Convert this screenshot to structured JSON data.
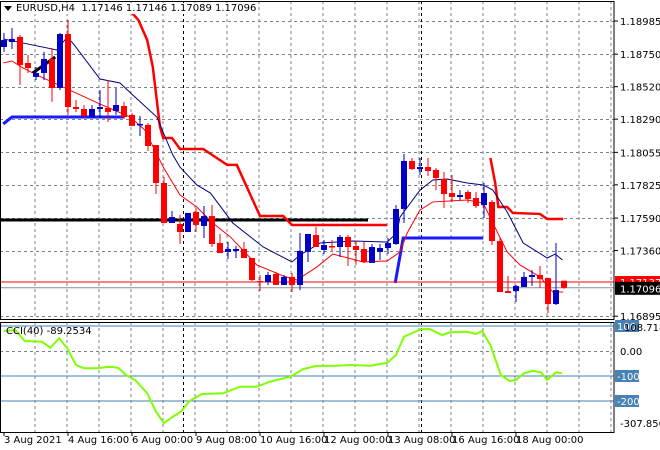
{
  "header": {
    "symbol": "EURUSD,H4",
    "open": "1.17146",
    "high": "1.17146",
    "low": "1.17089",
    "close": "1.17096"
  },
  "colors": {
    "bull": "#0000c8",
    "bear": "#ff0000",
    "doji": "#00c800",
    "ma_fast": "#ff0000",
    "ma_slow": "#000080",
    "stop_red": "#ff0000",
    "stop_blue": "#1a1aff",
    "level_black": "#000000",
    "cci": "#7fff00",
    "cci_levels": "#4682b4",
    "grid": "#7a8290"
  },
  "chart_data": [
    {
      "type": "candlestick",
      "title": "EURUSD,H4",
      "price_axis": {
        "ticks": [
          "1.18985",
          "1.18750",
          "1.18520",
          "1.18290",
          "1.18055",
          "1.17825",
          "1.17590",
          "1.17360",
          "1.16895"
        ],
        "range": [
          1.16895,
          1.18985
        ]
      },
      "time_axis": {
        "labels": [
          {
            "text": "3 Aug 2021",
            "bar": 1
          },
          {
            "text": "4 Aug 16:00",
            "bar": 9
          },
          {
            "text": "6 Aug 00:00",
            "bar": 17
          },
          {
            "text": "9 Aug 08:00",
            "bar": 25
          },
          {
            "text": "10 Aug 16:00",
            "bar": 33
          },
          {
            "text": "12 Aug 00:00",
            "bar": 41
          },
          {
            "text": "13 Aug 08:00",
            "bar": 49
          },
          {
            "text": "16 Aug 16:00",
            "bar": 57
          },
          {
            "text": "18 Aug 00:00",
            "bar": 65
          }
        ],
        "day_separators": [
          23.4,
          53.1
        ]
      },
      "ohlc": [
        [
          1.18801,
          1.189,
          1.18766,
          1.1885
        ],
        [
          1.18836,
          1.18935,
          1.18787,
          1.18858
        ],
        [
          1.18872,
          1.18886,
          1.18532,
          1.18673
        ],
        [
          1.18688,
          1.18744,
          1.18617,
          1.18652
        ],
        [
          1.18589,
          1.18659,
          1.18567,
          1.18617
        ],
        [
          1.18617,
          1.18766,
          1.18567,
          1.18716
        ],
        [
          1.18716,
          1.18794,
          1.18412,
          1.18511
        ],
        [
          1.18511,
          1.189,
          1.18496,
          1.18893
        ],
        [
          1.18893,
          1.18992,
          1.1832,
          1.18376
        ],
        [
          1.18376,
          1.18426,
          1.18341,
          1.18362
        ],
        [
          1.18362,
          1.1839,
          1.18305,
          1.18313
        ],
        [
          1.18305,
          1.1839,
          1.18298,
          1.18362
        ],
        [
          1.18362,
          1.18496,
          1.18298,
          1.18376
        ],
        [
          1.18369,
          1.18567,
          1.1827,
          1.18341
        ],
        [
          1.18348,
          1.18511,
          1.1832,
          1.1839
        ],
        [
          1.18383,
          1.18412,
          1.18298,
          1.18305
        ],
        [
          1.1832,
          1.18334,
          1.18242,
          1.18242
        ],
        [
          1.18256,
          1.18313,
          1.18171,
          1.18256
        ],
        [
          1.18249,
          1.18263,
          1.18065,
          1.181
        ],
        [
          1.18107,
          1.18107,
          1.1776,
          1.17838
        ],
        [
          1.17838,
          1.17881,
          1.17555,
          1.17555
        ],
        [
          1.17555,
          1.1764,
          1.17555,
          1.17597
        ],
        [
          1.17548,
          1.17612,
          1.17406,
          1.17491
        ],
        [
          1.17491,
          1.17626,
          1.17491,
          1.17626
        ],
        [
          1.17633,
          1.17661,
          1.17491,
          1.17541
        ],
        [
          1.17534,
          1.17675,
          1.17449,
          1.17604
        ],
        [
          1.17604,
          1.17682,
          1.17385,
          1.17406
        ],
        [
          1.17413,
          1.17477,
          1.17342,
          1.17342
        ],
        [
          1.1735,
          1.1742,
          1.173,
          1.17371
        ],
        [
          1.17357,
          1.17392,
          1.17307,
          1.17371
        ],
        [
          1.17371,
          1.1742,
          1.17307,
          1.17307
        ],
        [
          1.17307,
          1.17307,
          1.17144,
          1.17151
        ],
        [
          1.17144,
          1.17187,
          1.17073,
          1.17137
        ],
        [
          1.17137,
          1.17208,
          1.17116,
          1.17187
        ],
        [
          1.17194,
          1.17208,
          1.17116,
          1.17116
        ],
        [
          1.17116,
          1.17187,
          1.17116,
          1.17173
        ],
        [
          1.17173,
          1.17201,
          1.17066,
          1.17116
        ],
        [
          1.17116,
          1.17484,
          1.1708,
          1.17357
        ],
        [
          1.1735,
          1.17477,
          1.17279,
          1.17477
        ],
        [
          1.1747,
          1.17527,
          1.17385,
          1.17385
        ],
        [
          1.17364,
          1.17435,
          1.17335,
          1.17399
        ],
        [
          1.17392,
          1.17435,
          1.17357,
          1.17385
        ],
        [
          1.17385,
          1.1747,
          1.17314,
          1.17456
        ],
        [
          1.17456,
          1.1747,
          1.1725,
          1.17385
        ],
        [
          1.17392,
          1.17427,
          1.17258,
          1.17364
        ],
        [
          1.17371,
          1.1742,
          1.17272,
          1.17279
        ],
        [
          1.17272,
          1.17406,
          1.17272,
          1.17385
        ],
        [
          1.1735,
          1.17406,
          1.17293,
          1.17378
        ],
        [
          1.17378,
          1.17449,
          1.17335,
          1.17413
        ],
        [
          1.17406,
          1.17682,
          1.17399,
          1.17654
        ],
        [
          1.17654,
          1.18043,
          1.17555,
          1.17994
        ],
        [
          1.17994,
          1.18015,
          1.1793,
          1.17937
        ],
        [
          1.17937,
          1.18015,
          1.17895,
          1.17951
        ],
        [
          1.17951,
          1.18015,
          1.17888,
          1.17923
        ],
        [
          1.1793,
          1.17944,
          1.17788,
          1.17873
        ],
        [
          1.17866,
          1.17916,
          1.17661,
          1.1776
        ],
        [
          1.17767,
          1.17895,
          1.17704,
          1.17739
        ],
        [
          1.17739,
          1.17788,
          1.17718,
          1.17753
        ],
        [
          1.17774,
          1.17788,
          1.17696,
          1.17725
        ],
        [
          1.17732,
          1.17774,
          1.17661,
          1.17675
        ],
        [
          1.17682,
          1.17838,
          1.1759,
          1.17767
        ],
        [
          1.17704,
          1.17718,
          1.17399,
          1.17427
        ],
        [
          1.17427,
          1.17449,
          1.17066,
          1.17066
        ],
        [
          1.17073,
          1.1718,
          1.17059,
          1.17059
        ],
        [
          1.17073,
          1.17116,
          1.16996,
          1.17109
        ],
        [
          1.17102,
          1.17208,
          1.17102,
          1.17173
        ],
        [
          1.17173,
          1.17222,
          1.17109,
          1.17187
        ],
        [
          1.17187,
          1.1725,
          1.17095,
          1.17158
        ],
        [
          1.17165,
          1.17165,
          1.16918,
          1.16981
        ],
        [
          1.16981,
          1.17413,
          1.16974,
          1.1708
        ],
        [
          1.17146,
          1.17146,
          1.17089,
          1.17096
        ]
      ],
      "overlays": {
        "ma_slow": [
          [
            0.9,
            1.18858
          ],
          [
            7.6,
            1.1878
          ],
          [
            8.9,
            1.18872
          ],
          [
            9.6,
            1.18829
          ],
          [
            13,
            1.18574
          ],
          [
            15.5,
            1.18546
          ],
          [
            17.1,
            1.18461
          ],
          [
            20.1,
            1.18305
          ],
          [
            22.1,
            1.18036
          ],
          [
            23,
            1.17951
          ],
          [
            25.1,
            1.17824
          ],
          [
            26.8,
            1.17767
          ],
          [
            29.6,
            1.17555
          ],
          [
            33.4,
            1.17385
          ],
          [
            37,
            1.17279
          ],
          [
            38,
            1.17328
          ],
          [
            40.5,
            1.17413
          ],
          [
            44.6,
            1.17427
          ],
          [
            48.9,
            1.1742
          ],
          [
            50.1,
            1.17484
          ],
          [
            50.5,
            1.17597
          ],
          [
            53,
            1.17788
          ],
          [
            54.6,
            1.17859
          ],
          [
            56.4,
            1.17866
          ],
          [
            58.9,
            1.17838
          ],
          [
            60.9,
            1.17824
          ],
          [
            62.1,
            1.17788
          ],
          [
            63.9,
            1.17633
          ],
          [
            65.9,
            1.17413
          ],
          [
            68.9,
            1.17307
          ],
          [
            69.9,
            1.17335
          ],
          [
            70.8,
            1.17293
          ]
        ],
        "ma_fast": [
          [
            0.9,
            1.18688
          ],
          [
            2,
            1.18702
          ],
          [
            3.4,
            1.18652
          ],
          [
            5.1,
            1.18603
          ],
          [
            8.9,
            1.18504
          ],
          [
            13,
            1.18397
          ],
          [
            16.8,
            1.18305
          ],
          [
            18.6,
            1.18213
          ],
          [
            20.9,
            1.17951
          ],
          [
            23,
            1.17753
          ],
          [
            25.1,
            1.17668
          ],
          [
            27.1,
            1.17555
          ],
          [
            29.3,
            1.17456
          ],
          [
            32.6,
            1.17258
          ],
          [
            35.9,
            1.1718
          ],
          [
            37.6,
            1.17151
          ],
          [
            40.1,
            1.17243
          ],
          [
            42.1,
            1.17335
          ],
          [
            45.9,
            1.17279
          ],
          [
            48.9,
            1.17286
          ],
          [
            50.5,
            1.1735
          ],
          [
            51.4,
            1.17484
          ],
          [
            53,
            1.17647
          ],
          [
            54.6,
            1.17704
          ],
          [
            58.9,
            1.17718
          ],
          [
            60.9,
            1.17696
          ],
          [
            62.1,
            1.17555
          ],
          [
            63.9,
            1.1735
          ],
          [
            65.5,
            1.17258
          ],
          [
            68,
            1.17173
          ],
          [
            69.6,
            1.17066
          ],
          [
            70.9,
            1.17066
          ]
        ],
        "stop_red": [
          [
            [
              17,
              1.19042
            ],
            [
              17.8,
              1.18992
            ],
            [
              18.9,
              1.1885
            ],
            [
              19.6,
              1.18659
            ],
            [
              20.5,
              1.18235
            ],
            [
              20.9,
              1.18157
            ],
            [
              22,
              1.18157
            ],
            [
              23,
              1.18079
            ],
            [
              25.9,
              1.18079
            ],
            [
              28.9,
              1.17966
            ],
            [
              30.1,
              1.17966
            ],
            [
              33,
              1.17604
            ],
            [
              35.9,
              1.17604
            ],
            [
              37,
              1.17541
            ],
            [
              48.9,
              1.17541
            ]
          ],
          [
            [
              61.8,
              1.18015
            ],
            [
              62.4,
              1.17838
            ],
            [
              62.8,
              1.17668
            ],
            [
              63.9,
              1.17668
            ],
            [
              64.6,
              1.17626
            ],
            [
              68,
              1.17619
            ],
            [
              68.9,
              1.17583
            ],
            [
              70.9,
              1.17583
            ]
          ]
        ],
        "stop_blue": [
          [
            [
              0.9,
              1.18256
            ],
            [
              2,
              1.18305
            ],
            [
              16.1,
              1.18305
            ]
          ],
          [
            [
              49.9,
              1.1713
            ],
            [
              50.9,
              1.17449
            ],
            [
              60.9,
              1.17449
            ]
          ]
        ],
        "level_black": [
          [
            0.5,
            1.17576
          ],
          [
            46.5,
            1.17576
          ]
        ],
        "trend_black": [
          [
            4.6,
            1.18617
          ],
          [
            7.4,
            1.1873
          ]
        ]
      },
      "price_lines": {
        "ask": {
          "value": 1.17137,
          "label": "1.17137"
        },
        "bid": {
          "value": 1.17096,
          "label": "1.17096"
        }
      }
    },
    {
      "type": "line",
      "title": "CCI(40)",
      "value_label": "-89.2534",
      "axis": {
        "max_label": "108.7187",
        "min_label": "-307.8564",
        "zero_label": "0.00",
        "range": [
          -307.8564,
          108.7187
        ]
      },
      "levels": [
        {
          "value": 100,
          "label": "100"
        },
        {
          "value": -100,
          "label": "-100"
        },
        {
          "value": -200,
          "label": "-200"
        }
      ],
      "points": [
        [
          1,
          80
        ],
        [
          2.4,
          84
        ],
        [
          3.6,
          40
        ],
        [
          5.75,
          37
        ],
        [
          6.8,
          13
        ],
        [
          7.9,
          51
        ],
        [
          8.9,
          11
        ],
        [
          10,
          -56
        ],
        [
          11,
          -69
        ],
        [
          12.6,
          -69
        ],
        [
          14.2,
          -63
        ],
        [
          15.25,
          -67
        ],
        [
          16.25,
          -96
        ],
        [
          17.4,
          -116
        ],
        [
          18.9,
          -169
        ],
        [
          20,
          -243
        ],
        [
          21,
          -289
        ],
        [
          22.1,
          -263
        ],
        [
          23.1,
          -243
        ],
        [
          24.2,
          -200
        ],
        [
          25.75,
          -172
        ],
        [
          28.4,
          -169
        ],
        [
          30.5,
          -143
        ],
        [
          32.6,
          -143
        ],
        [
          34.2,
          -123
        ],
        [
          36.8,
          -103
        ],
        [
          38.4,
          -72
        ],
        [
          40,
          -60
        ],
        [
          42.6,
          -59
        ],
        [
          44.2,
          -56
        ],
        [
          46.8,
          -59
        ],
        [
          48.9,
          -47
        ],
        [
          50,
          -16
        ],
        [
          51,
          57
        ],
        [
          53.1,
          87
        ],
        [
          54.2,
          88
        ],
        [
          55.75,
          64
        ],
        [
          56.8,
          75
        ],
        [
          58.9,
          77
        ],
        [
          60,
          68
        ],
        [
          60.75,
          80
        ],
        [
          61.8,
          24
        ],
        [
          63.1,
          -96
        ],
        [
          64.2,
          -120
        ],
        [
          65,
          -116
        ],
        [
          66,
          -89
        ],
        [
          67.1,
          -79
        ],
        [
          68.1,
          -85
        ],
        [
          68.9,
          -116
        ],
        [
          70,
          -85
        ],
        [
          70.75,
          -89.25
        ]
      ]
    }
  ]
}
